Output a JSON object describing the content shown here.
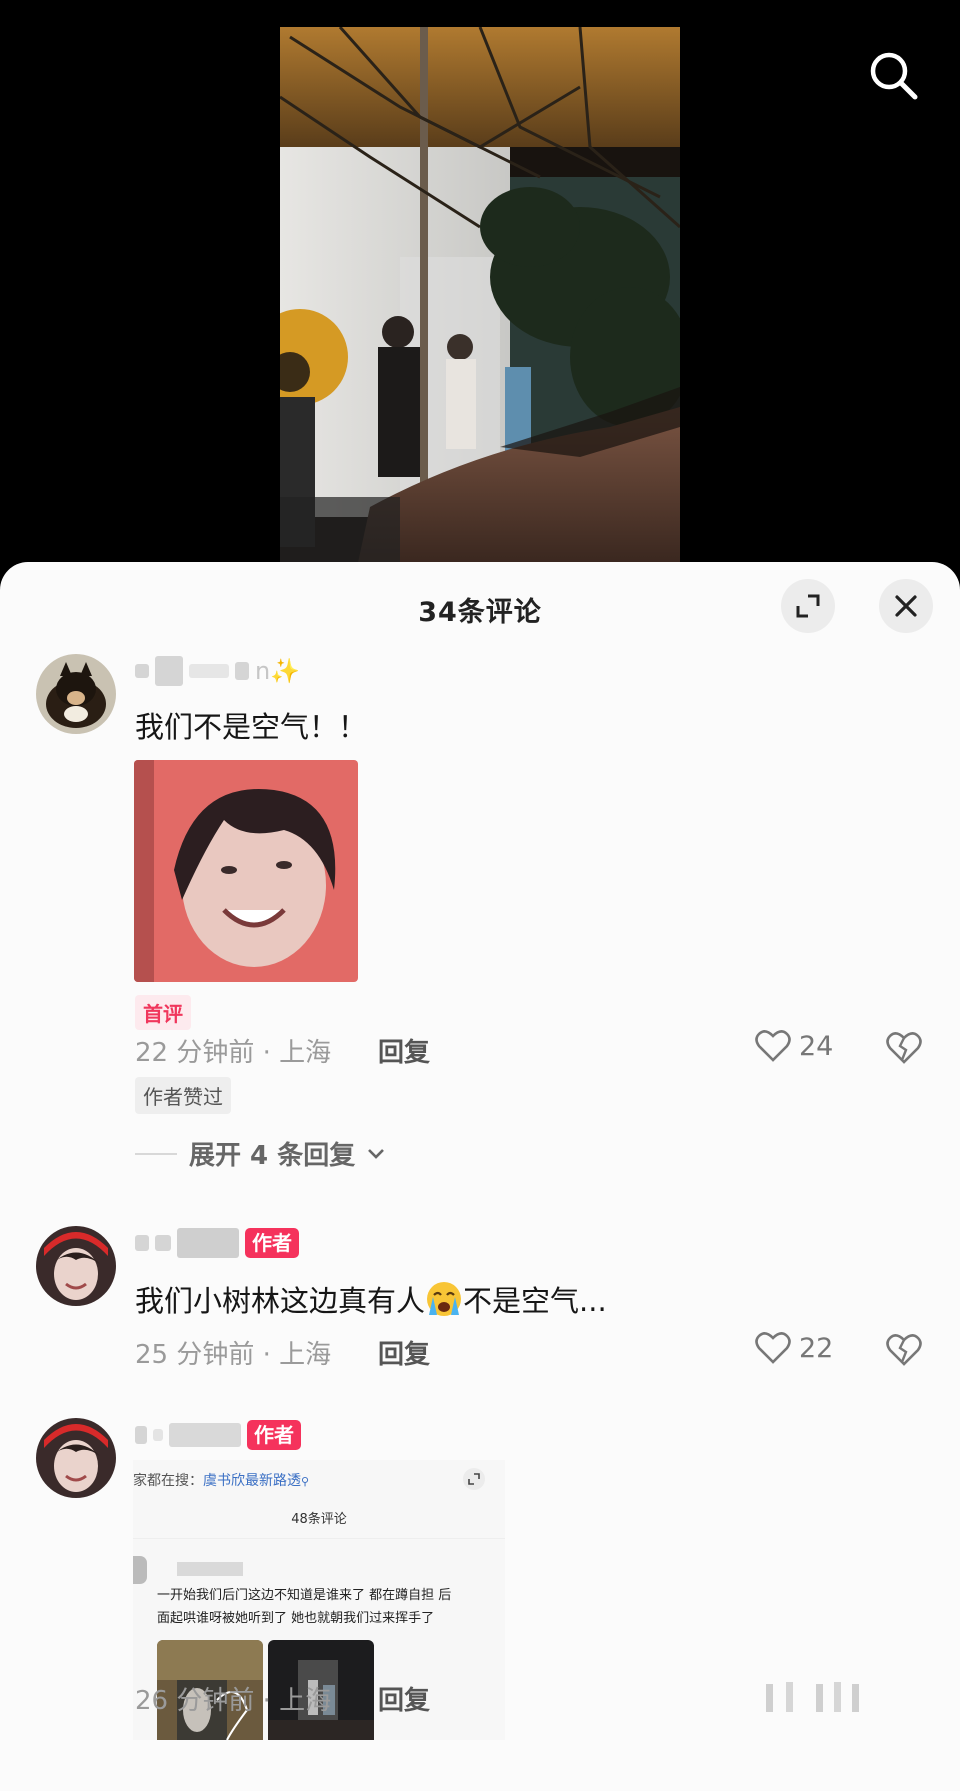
{
  "header": {
    "search_icon": "search-icon"
  },
  "sheet": {
    "title": "34条评论",
    "expand_icon": "expand-icon",
    "close_icon": "close-icon"
  },
  "comments": [
    {
      "username_suffix": "n✨",
      "text": "我们不是空气！！",
      "first_tag": "首评",
      "time": "22 分钟前",
      "location": "上海",
      "reply_label": "回复",
      "likes": "24",
      "author_liked": "作者赞过",
      "expand_replies": "展开 4 条回复"
    },
    {
      "badge": "作者",
      "text_before_emoji": "我们小树林这边真有人",
      "text_after_emoji": "不是空气...",
      "time": "25 分钟前",
      "location": "上海",
      "reply_label": "回复",
      "likes": "22"
    },
    {
      "badge": "作者",
      "time": "26 分钟前",
      "location": "上海",
      "reply_label": "回复",
      "nested": {
        "search_hint_prefix": "家都在搜：",
        "search_hint_link": "虞书欣最新路透",
        "comment_count": "48条评论",
        "line1": "一开始我们后门这边不知道是谁来了    都在蹲自担 后",
        "line2": "面起哄谁呀被她听到了 她也就朝我们过来挥手了"
      }
    }
  ],
  "colors": {
    "badge": "#f5325c",
    "sheet_bg": "#fbfbfb",
    "meta": "#9a9a9a"
  }
}
